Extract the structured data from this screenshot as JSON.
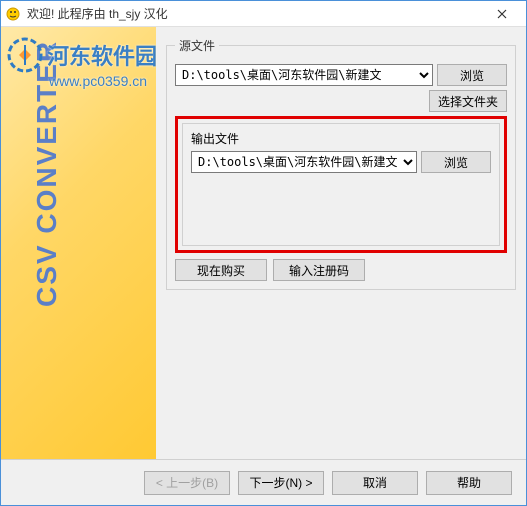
{
  "title": "欢迎!        此程序由 th_sjy 汉化",
  "watermark": {
    "text": "河东软件园",
    "url": "www.pc0359.cn"
  },
  "sidebar": {
    "logo_text": "CSV CONVERTER"
  },
  "source": {
    "legend": "源文件",
    "path": "D:\\tools\\桌面\\河东软件园\\新建文",
    "browse": "浏览",
    "select_folder": "选择文件夹"
  },
  "output": {
    "legend": "输出文件",
    "path": "D:\\tools\\桌面\\河东软件园\\新建文",
    "browse": "浏览"
  },
  "actions": {
    "buy_now": "现在购买",
    "enter_reg": "输入注册码"
  },
  "footer": {
    "back": "< 上一步(B)",
    "next": "下一步(N) >",
    "cancel": "取消",
    "help": "帮助"
  }
}
